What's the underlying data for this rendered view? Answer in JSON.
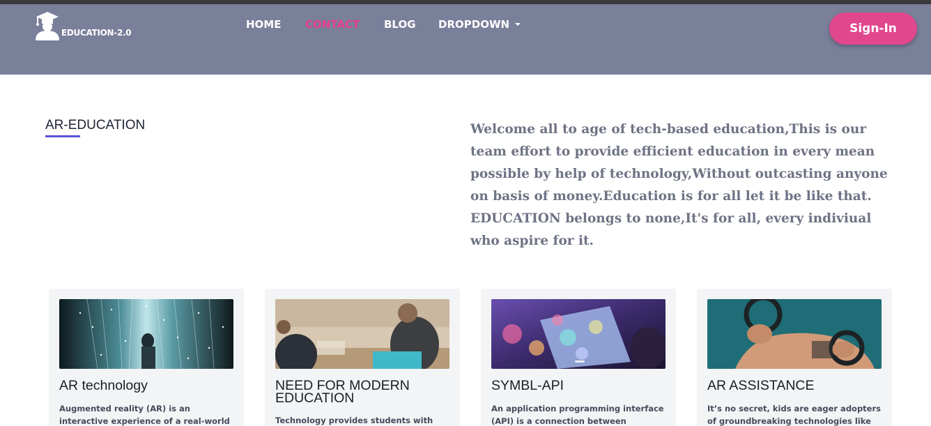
{
  "brand": {
    "name": "EDUCATION-2.0",
    "logo_icon": "graduate-cap-icon"
  },
  "nav": {
    "items": [
      {
        "label": "HOME",
        "active": false
      },
      {
        "label": "CONTACT",
        "active": true
      },
      {
        "label": "BLOG",
        "active": false
      },
      {
        "label": "DROPDOWN",
        "active": false,
        "has_caret": true
      }
    ]
  },
  "signin": {
    "label": "Sign-In"
  },
  "section": {
    "label": "AR-EDUCATION"
  },
  "welcome": {
    "paragraph1": "Welcome all to age of tech-based education,This is our team effort to provide efficient education in every mean possible by help of technology,Without outcasting anyone on basis of money.Education is for all let it be like that.",
    "paragraph2": "EDUCATION belongs to none,It's for all, every indiviual who aspire for it."
  },
  "cards": [
    {
      "title": "AR technology",
      "text": "Augmented reality (AR) is an interactive experience of a real-world environment"
    },
    {
      "title": "NEED FOR MODERN EDUCATION",
      "text": "Technology provides students with easy-"
    },
    {
      "title": "SYMBL-API",
      "text": "An application programming interface (API) is a connection between computers"
    },
    {
      "title": "AR ASSISTANCE",
      "text": "It’s no secret, kids are eager adopters of groundbreaking technologies like AR."
    }
  ],
  "colors": {
    "header_bg": "#7a7f9a",
    "accent_pink": "#e0478c",
    "underline": "#5a55d6"
  }
}
